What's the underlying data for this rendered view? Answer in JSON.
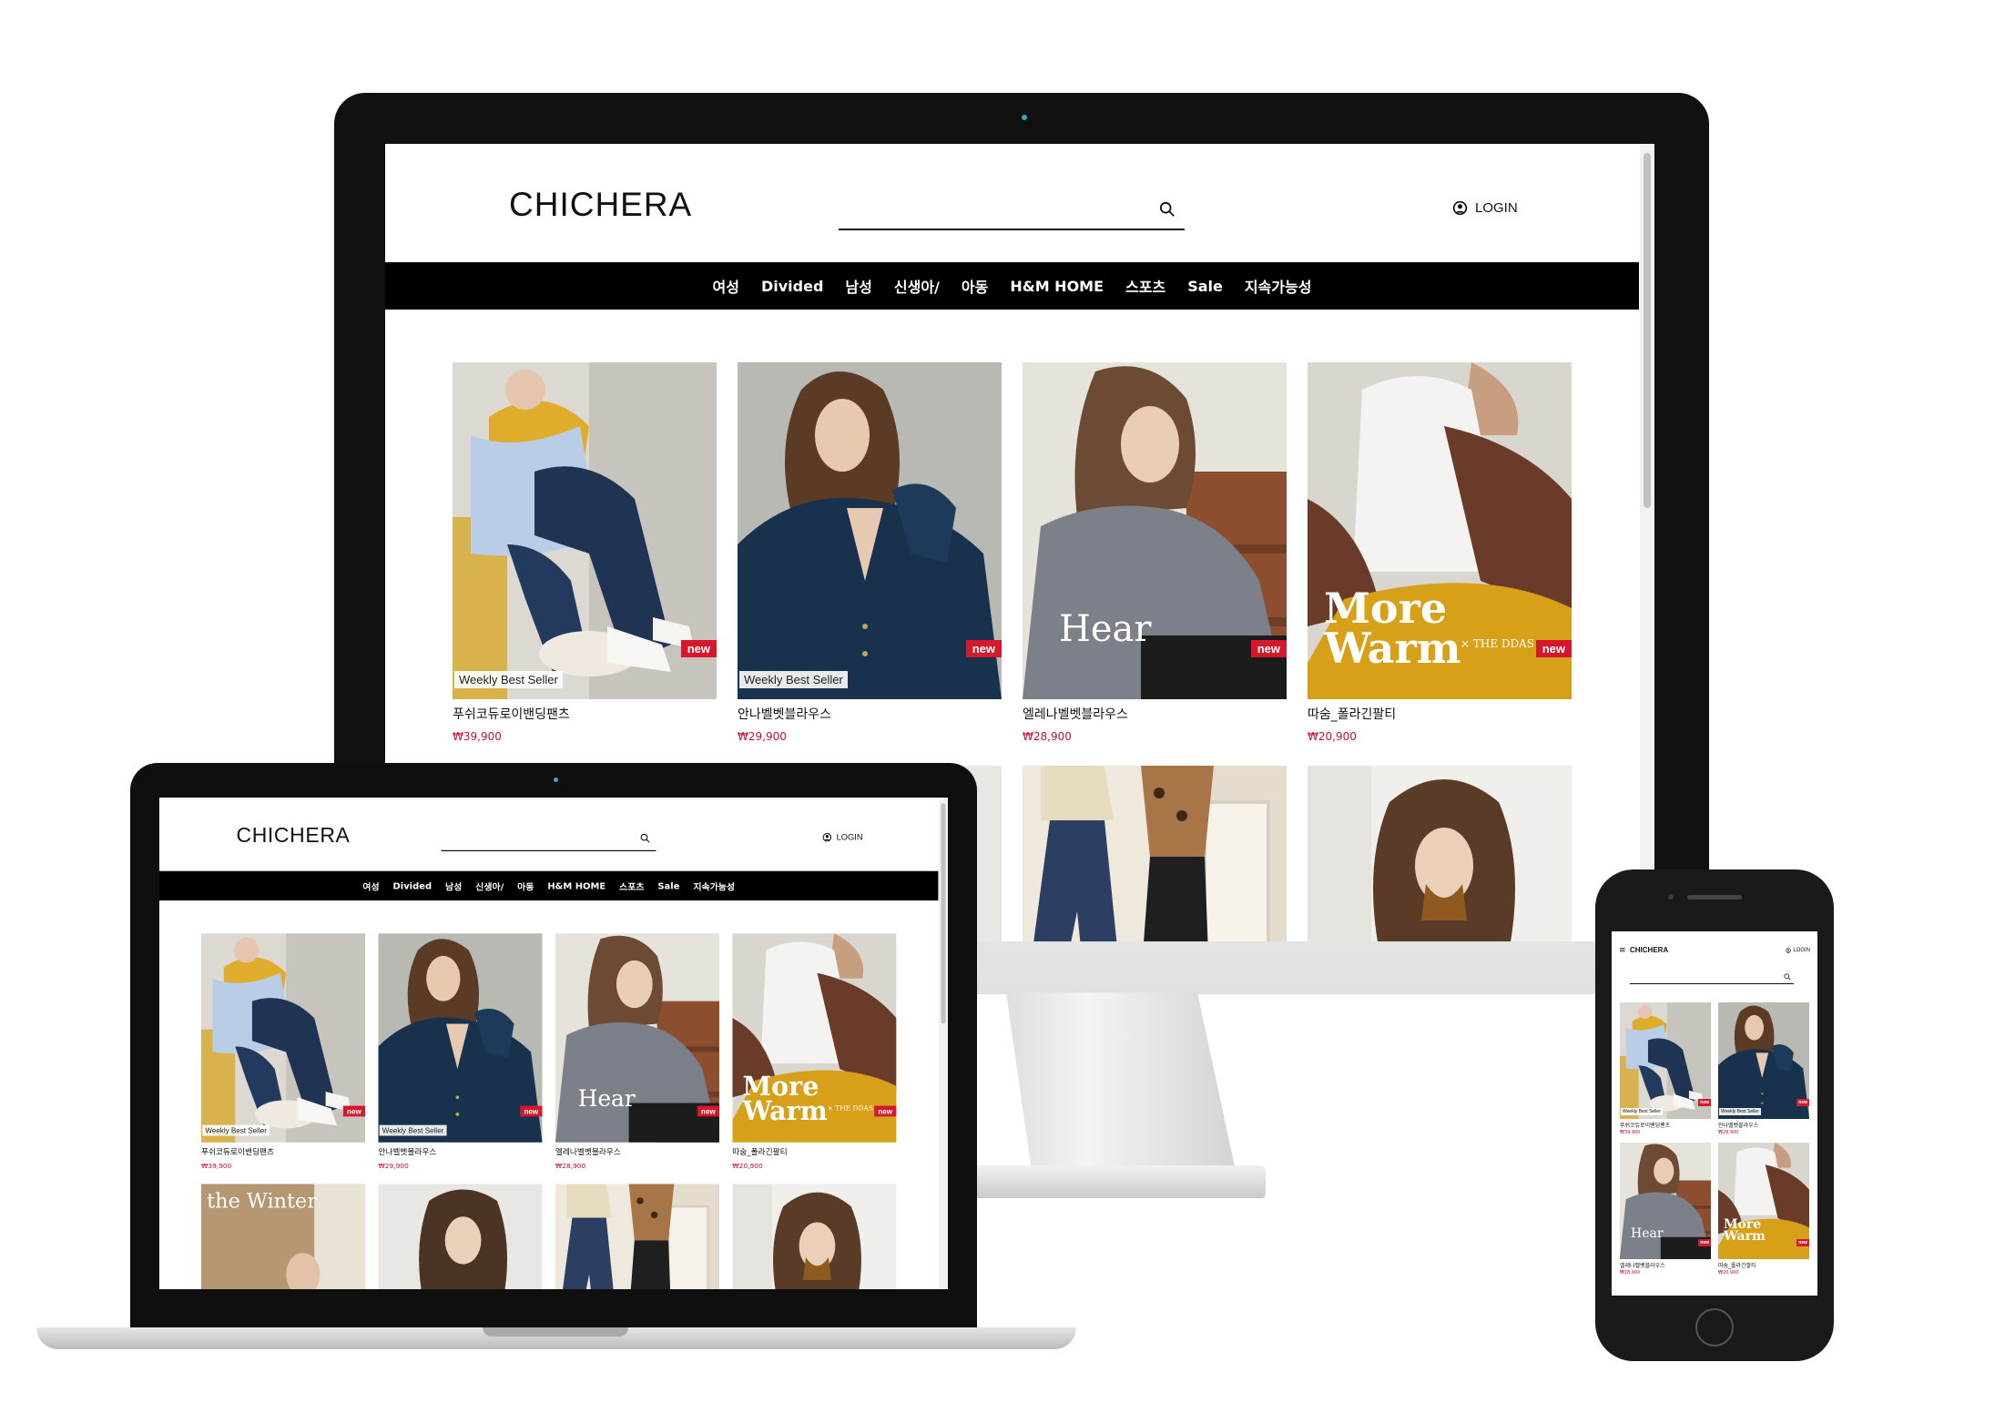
{
  "site": {
    "logo": "CHICHERA",
    "search_placeholder": "",
    "login_label": "LOGIN",
    "nav": [
      "여성",
      "Divided",
      "남성",
      "신생아/",
      "아동",
      "H&M HOME",
      "스포츠",
      "Sale",
      "지속가능성"
    ]
  },
  "products": [
    {
      "name": "푸쉬코듀로이밴딩팬츠",
      "price": "₩39,900",
      "best": "Weekly Best Seller",
      "new": "new"
    },
    {
      "name": "안나벨벳블라우스",
      "price": "₩29,900",
      "best": "Weekly Best Seller",
      "new": "new"
    },
    {
      "name": "엘레나벨벳블라우스",
      "price": "₩28,900",
      "best": "",
      "new": "new"
    },
    {
      "name": "따숨_폴라긴팔티",
      "price": "₩20,900",
      "best": "",
      "new": "new"
    }
  ],
  "overlays": {
    "more_warm": "More Warm",
    "the_ddas": "× THE DDAS",
    "hear": "Hear",
    "the_winter": "the Winter"
  },
  "colors": {
    "nav_bg": "#000000",
    "price": "#c8102e",
    "new_badge": "#d6182c",
    "device_frame": "#111111"
  },
  "icons": {
    "search": "search-icon",
    "user": "user-circle-icon",
    "menu": "hamburger-menu-icon"
  },
  "mobile": {
    "menu_glyph": "≡"
  }
}
